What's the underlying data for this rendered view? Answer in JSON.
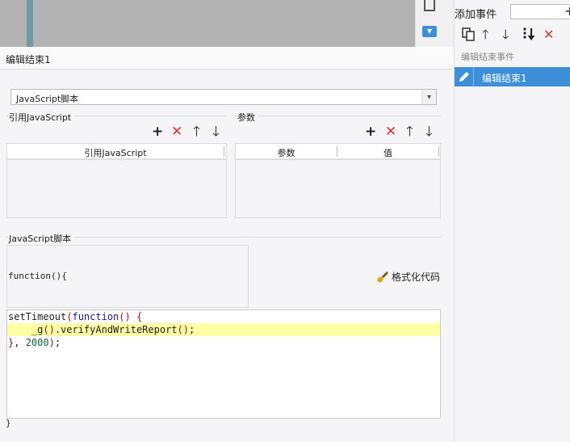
{
  "right_panel": {
    "add_event_label": "添加事件",
    "add_icon": "plus-icon",
    "toolbar_icons": [
      "copy-icon",
      "arrow-up-icon",
      "arrow-down-icon",
      "move-bottom-icon",
      "delete-icon"
    ],
    "section_title": "编辑结束事件",
    "selected_event": "编辑结束1",
    "selected_event_icon": "pencil-icon"
  },
  "form": {
    "title": "编辑结束1",
    "type_select_value": "JavaScript脚本",
    "ref_js_section": "引用JavaScript",
    "ref_js_column": "引用JavaScript",
    "params_section": "参数",
    "params_columns": [
      "参数",
      "值"
    ],
    "script_section": "JavaScript脚本",
    "fn_open": "function(){",
    "format_button": "格式化代码",
    "fn_close": "}"
  },
  "colors": {
    "accent": "#3c8fd8",
    "delete": "#e0302d",
    "highlight_line": "#ffffa6"
  }
}
